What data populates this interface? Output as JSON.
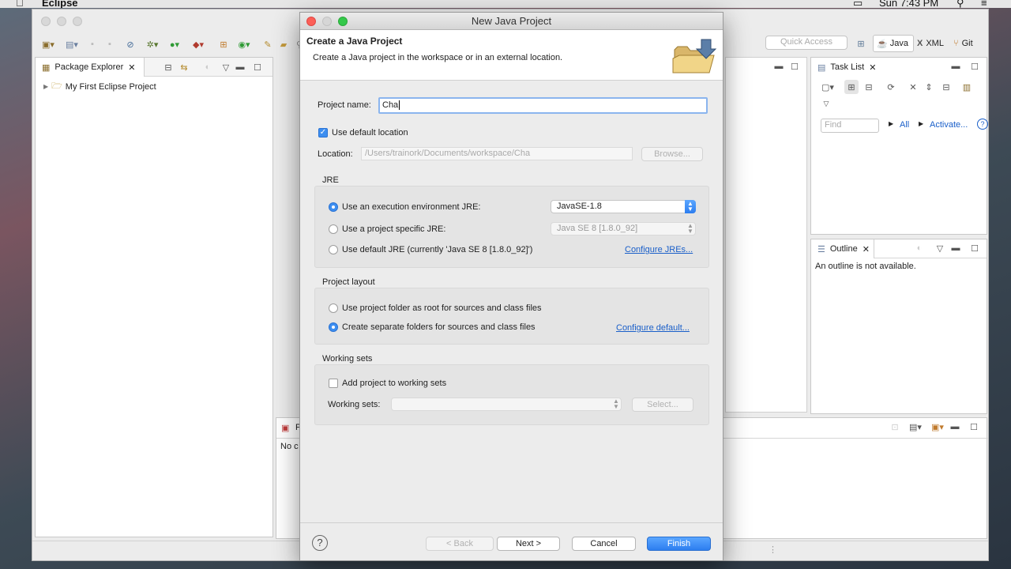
{
  "menubar": {
    "app_name": "Eclipse",
    "clock": "Sun 7:43 PM"
  },
  "eclipse": {
    "quick_access_placeholder": "Quick Access",
    "perspectives": {
      "java": "Java",
      "xml": "XML",
      "git": "Git"
    },
    "package_explorer": {
      "title": "Package Explorer",
      "project": "My First Eclipse Project"
    },
    "task_list": {
      "title": "Task List",
      "find_placeholder": "Find",
      "all": "All",
      "activate": "Activate..."
    },
    "outline": {
      "title": "Outline",
      "message": "An outline is not available."
    },
    "bottom": {
      "tab_initial": "P",
      "text": "No c"
    }
  },
  "dialog": {
    "window_title": "New Java Project",
    "header_title": "Create a Java Project",
    "header_desc": "Create a Java project in the workspace or in an external location.",
    "project_name_label": "Project name:",
    "project_name_value": "Cha",
    "use_default_location": "Use default location",
    "location_label": "Location:",
    "location_value": "/Users/trainork/Documents/workspace/Cha",
    "browse": "Browse...",
    "jre": {
      "title": "JRE",
      "exec_env": "Use an execution environment JRE:",
      "exec_env_value": "JavaSE-1.8",
      "specific": "Use a project specific JRE:",
      "specific_value": "Java SE 8 [1.8.0_92]",
      "default": "Use default JRE (currently 'Java SE 8 [1.8.0_92]')",
      "configure": "Configure JREs..."
    },
    "layout": {
      "title": "Project layout",
      "root": "Use project folder as root for sources and class files",
      "separate": "Create separate folders for sources and class files",
      "configure": "Configure default..."
    },
    "working_sets": {
      "title": "Working sets",
      "add": "Add project to working sets",
      "label": "Working sets:",
      "select": "Select..."
    },
    "buttons": {
      "help": "?",
      "back": "< Back",
      "next": "Next >",
      "cancel": "Cancel",
      "finish": "Finish"
    }
  }
}
